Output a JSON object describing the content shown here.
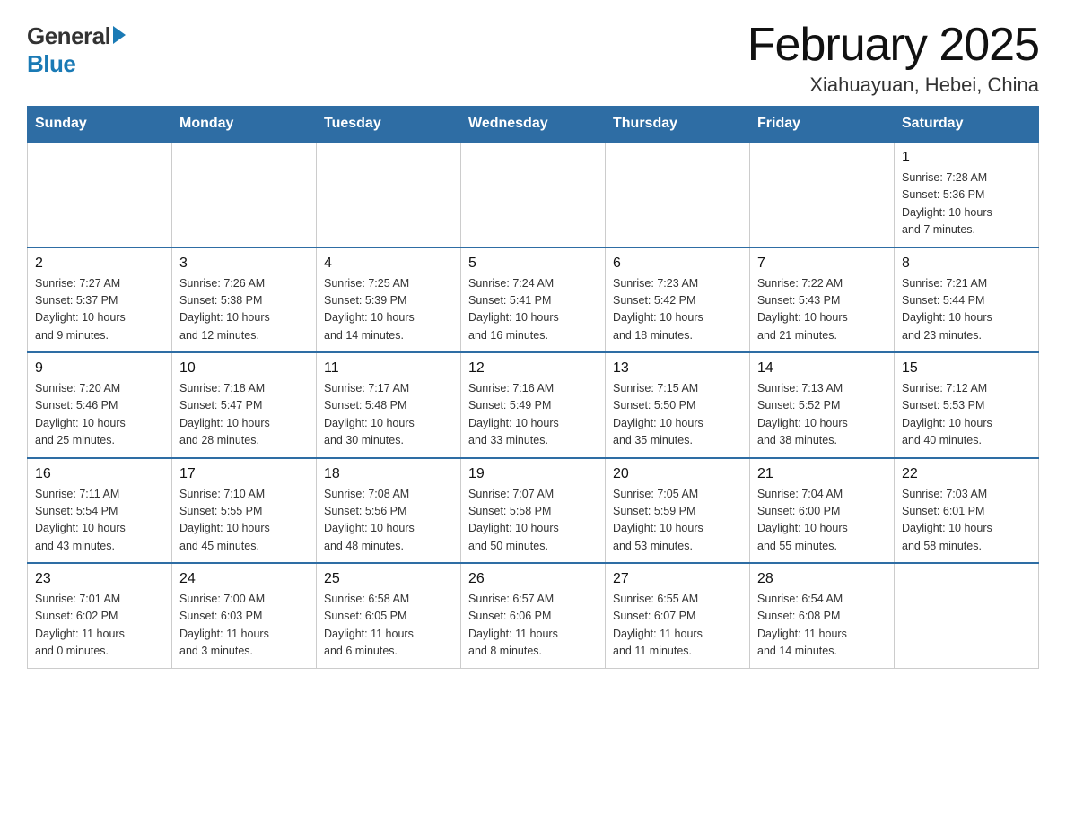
{
  "logo": {
    "general": "General",
    "blue": "Blue"
  },
  "header": {
    "title": "February 2025",
    "subtitle": "Xiahuayuan, Hebei, China"
  },
  "weekdays": [
    "Sunday",
    "Monday",
    "Tuesday",
    "Wednesday",
    "Thursday",
    "Friday",
    "Saturday"
  ],
  "weeks": [
    [
      {
        "day": "",
        "info": ""
      },
      {
        "day": "",
        "info": ""
      },
      {
        "day": "",
        "info": ""
      },
      {
        "day": "",
        "info": ""
      },
      {
        "day": "",
        "info": ""
      },
      {
        "day": "",
        "info": ""
      },
      {
        "day": "1",
        "info": "Sunrise: 7:28 AM\nSunset: 5:36 PM\nDaylight: 10 hours\nand 7 minutes."
      }
    ],
    [
      {
        "day": "2",
        "info": "Sunrise: 7:27 AM\nSunset: 5:37 PM\nDaylight: 10 hours\nand 9 minutes."
      },
      {
        "day": "3",
        "info": "Sunrise: 7:26 AM\nSunset: 5:38 PM\nDaylight: 10 hours\nand 12 minutes."
      },
      {
        "day": "4",
        "info": "Sunrise: 7:25 AM\nSunset: 5:39 PM\nDaylight: 10 hours\nand 14 minutes."
      },
      {
        "day": "5",
        "info": "Sunrise: 7:24 AM\nSunset: 5:41 PM\nDaylight: 10 hours\nand 16 minutes."
      },
      {
        "day": "6",
        "info": "Sunrise: 7:23 AM\nSunset: 5:42 PM\nDaylight: 10 hours\nand 18 minutes."
      },
      {
        "day": "7",
        "info": "Sunrise: 7:22 AM\nSunset: 5:43 PM\nDaylight: 10 hours\nand 21 minutes."
      },
      {
        "day": "8",
        "info": "Sunrise: 7:21 AM\nSunset: 5:44 PM\nDaylight: 10 hours\nand 23 minutes."
      }
    ],
    [
      {
        "day": "9",
        "info": "Sunrise: 7:20 AM\nSunset: 5:46 PM\nDaylight: 10 hours\nand 25 minutes."
      },
      {
        "day": "10",
        "info": "Sunrise: 7:18 AM\nSunset: 5:47 PM\nDaylight: 10 hours\nand 28 minutes."
      },
      {
        "day": "11",
        "info": "Sunrise: 7:17 AM\nSunset: 5:48 PM\nDaylight: 10 hours\nand 30 minutes."
      },
      {
        "day": "12",
        "info": "Sunrise: 7:16 AM\nSunset: 5:49 PM\nDaylight: 10 hours\nand 33 minutes."
      },
      {
        "day": "13",
        "info": "Sunrise: 7:15 AM\nSunset: 5:50 PM\nDaylight: 10 hours\nand 35 minutes."
      },
      {
        "day": "14",
        "info": "Sunrise: 7:13 AM\nSunset: 5:52 PM\nDaylight: 10 hours\nand 38 minutes."
      },
      {
        "day": "15",
        "info": "Sunrise: 7:12 AM\nSunset: 5:53 PM\nDaylight: 10 hours\nand 40 minutes."
      }
    ],
    [
      {
        "day": "16",
        "info": "Sunrise: 7:11 AM\nSunset: 5:54 PM\nDaylight: 10 hours\nand 43 minutes."
      },
      {
        "day": "17",
        "info": "Sunrise: 7:10 AM\nSunset: 5:55 PM\nDaylight: 10 hours\nand 45 minutes."
      },
      {
        "day": "18",
        "info": "Sunrise: 7:08 AM\nSunset: 5:56 PM\nDaylight: 10 hours\nand 48 minutes."
      },
      {
        "day": "19",
        "info": "Sunrise: 7:07 AM\nSunset: 5:58 PM\nDaylight: 10 hours\nand 50 minutes."
      },
      {
        "day": "20",
        "info": "Sunrise: 7:05 AM\nSunset: 5:59 PM\nDaylight: 10 hours\nand 53 minutes."
      },
      {
        "day": "21",
        "info": "Sunrise: 7:04 AM\nSunset: 6:00 PM\nDaylight: 10 hours\nand 55 minutes."
      },
      {
        "day": "22",
        "info": "Sunrise: 7:03 AM\nSunset: 6:01 PM\nDaylight: 10 hours\nand 58 minutes."
      }
    ],
    [
      {
        "day": "23",
        "info": "Sunrise: 7:01 AM\nSunset: 6:02 PM\nDaylight: 11 hours\nand 0 minutes."
      },
      {
        "day": "24",
        "info": "Sunrise: 7:00 AM\nSunset: 6:03 PM\nDaylight: 11 hours\nand 3 minutes."
      },
      {
        "day": "25",
        "info": "Sunrise: 6:58 AM\nSunset: 6:05 PM\nDaylight: 11 hours\nand 6 minutes."
      },
      {
        "day": "26",
        "info": "Sunrise: 6:57 AM\nSunset: 6:06 PM\nDaylight: 11 hours\nand 8 minutes."
      },
      {
        "day": "27",
        "info": "Sunrise: 6:55 AM\nSunset: 6:07 PM\nDaylight: 11 hours\nand 11 minutes."
      },
      {
        "day": "28",
        "info": "Sunrise: 6:54 AM\nSunset: 6:08 PM\nDaylight: 11 hours\nand 14 minutes."
      },
      {
        "day": "",
        "info": ""
      }
    ]
  ]
}
